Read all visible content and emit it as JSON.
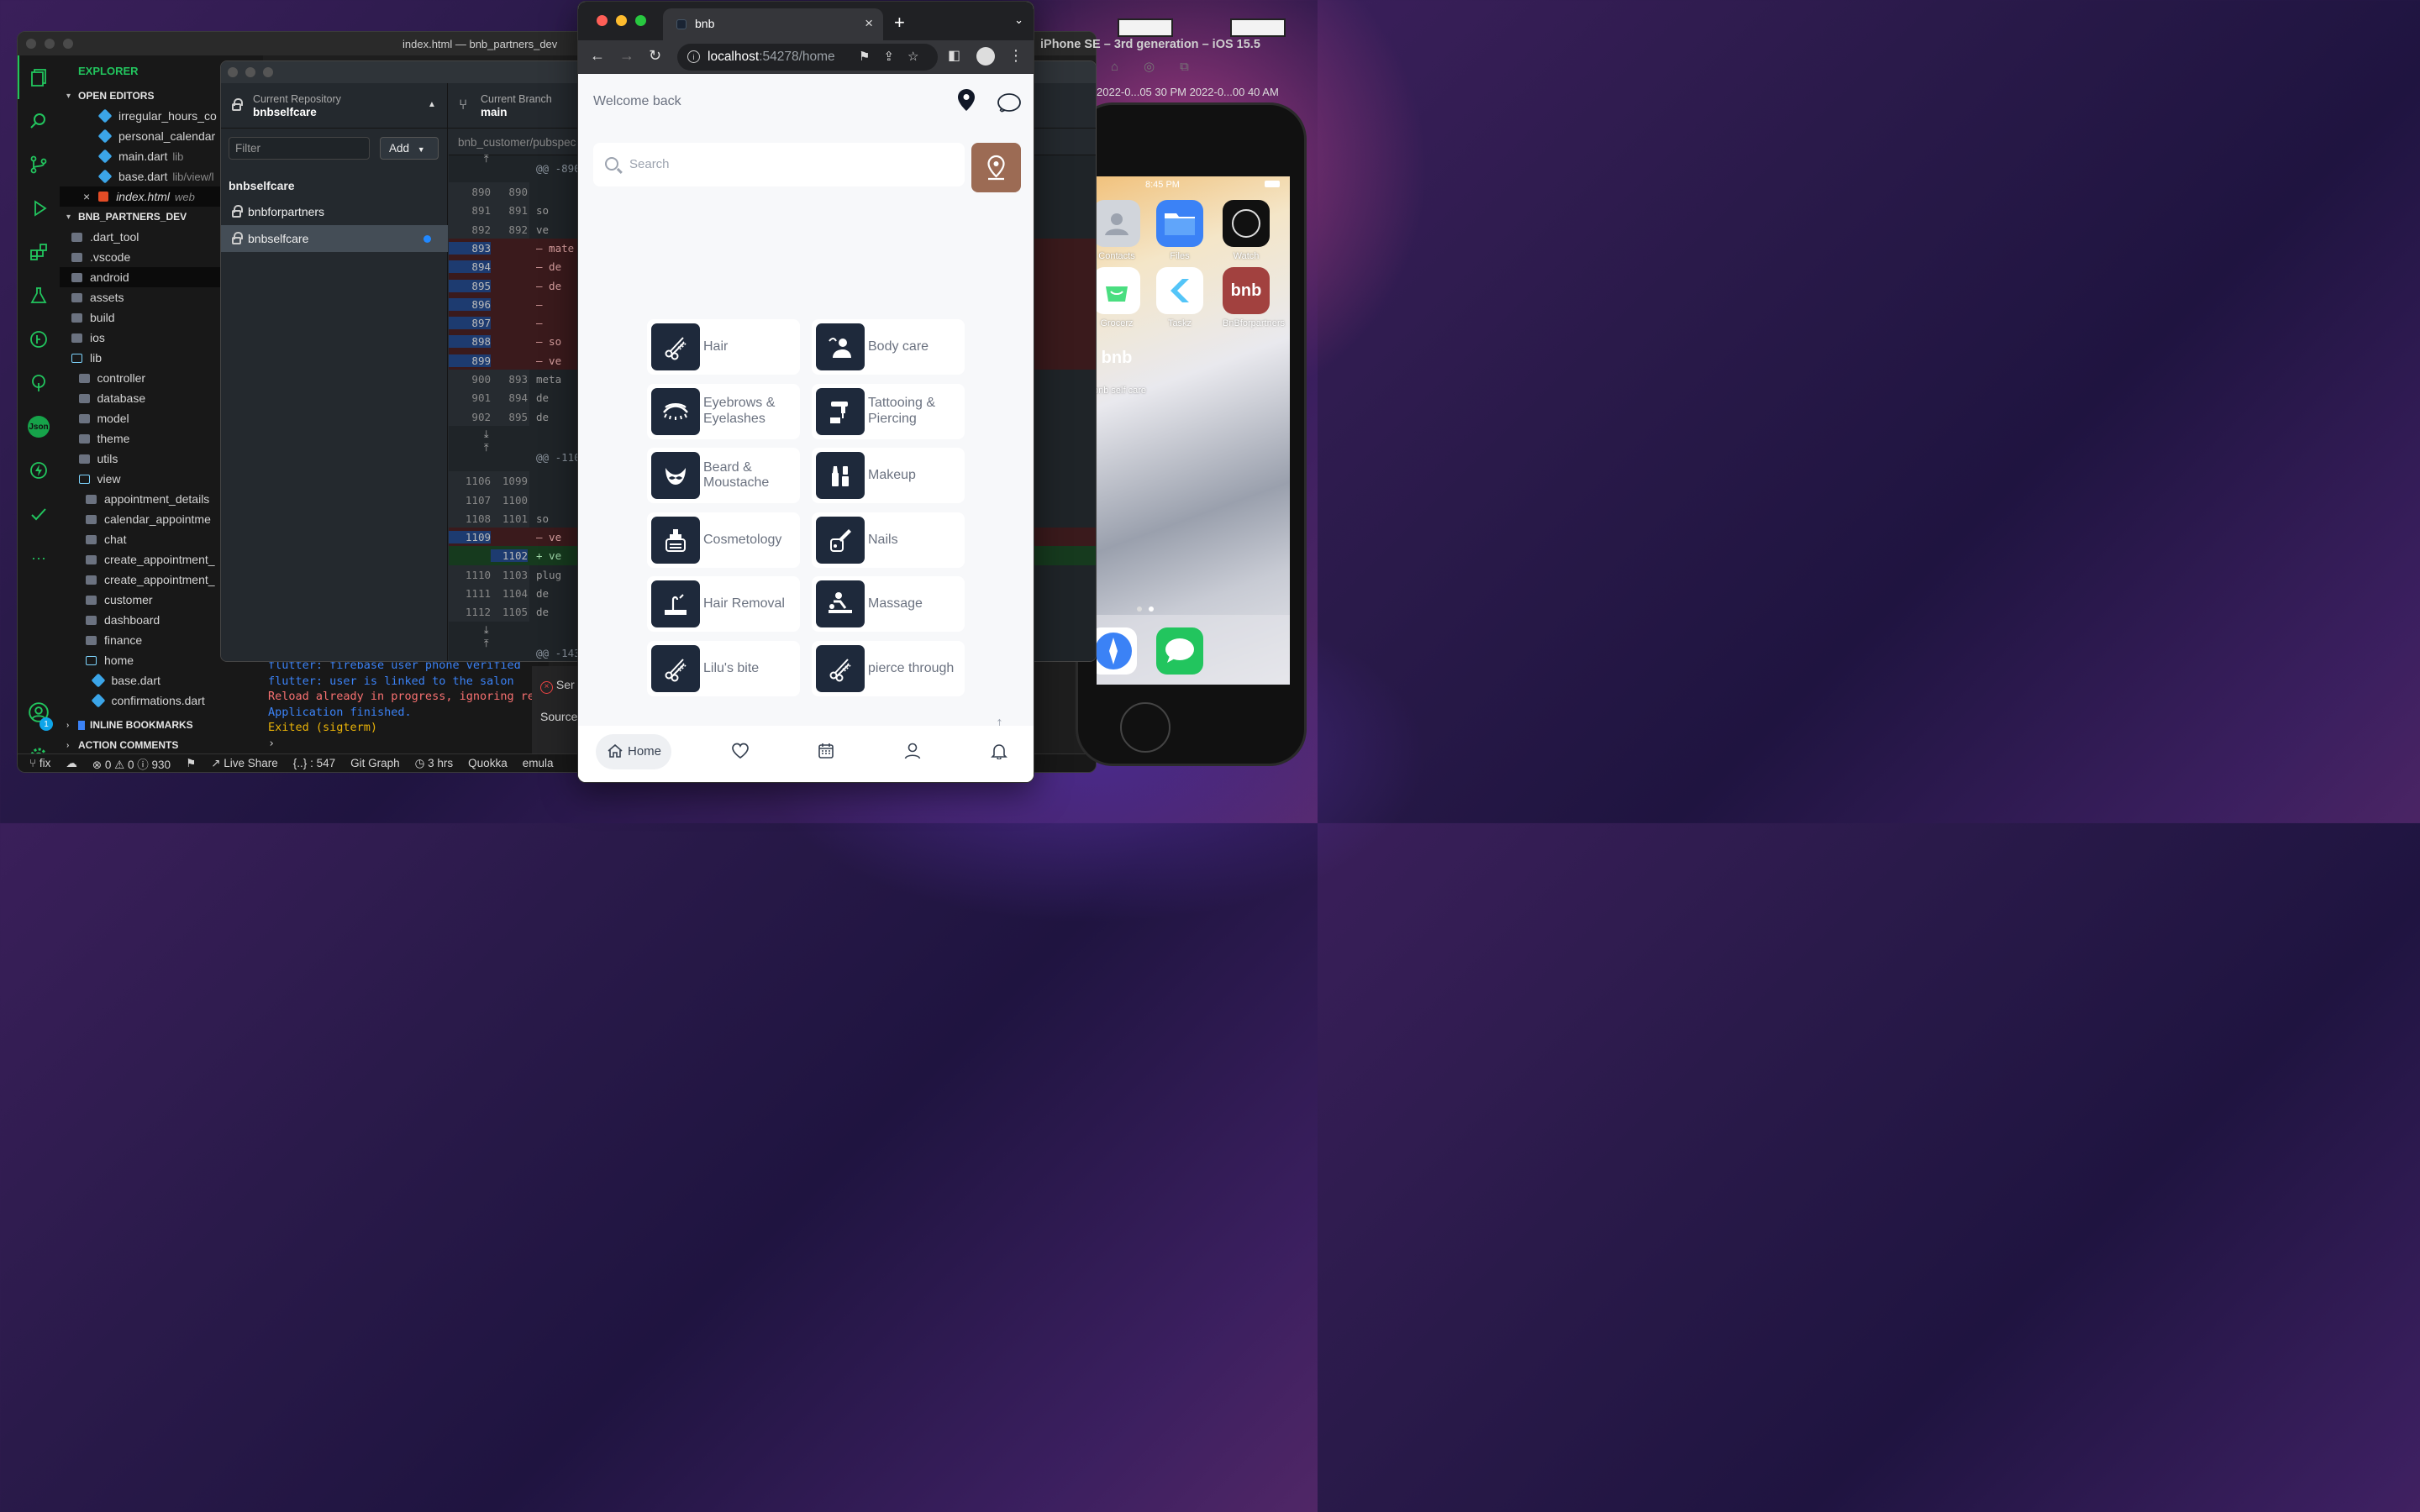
{
  "vscode": {
    "window_title": "index.html — bnb_partners_dev",
    "explorer_title": "EXPLORER",
    "open_editors_header": "OPEN EDITORS",
    "open_editors": [
      {
        "name": "irregular_hours_co",
        "hint": ""
      },
      {
        "name": "personal_calendar",
        "hint": ""
      },
      {
        "name": "main.dart",
        "hint": "lib"
      },
      {
        "name": "base.dart",
        "hint": "lib/view/l"
      },
      {
        "name": "index.html",
        "hint": "web"
      }
    ],
    "project_header": "BNB_PARTNERS_DEV",
    "tree": [
      {
        "name": ".dart_tool",
        "indent": 0
      },
      {
        "name": ".vscode",
        "indent": 0
      },
      {
        "name": "android",
        "indent": 0
      },
      {
        "name": "assets",
        "indent": 0
      },
      {
        "name": "build",
        "indent": 0
      },
      {
        "name": "ios",
        "indent": 0
      },
      {
        "name": "lib",
        "indent": 0
      },
      {
        "name": "controller",
        "indent": 1
      },
      {
        "name": "database",
        "indent": 1
      },
      {
        "name": "model",
        "indent": 1
      },
      {
        "name": "theme",
        "indent": 1
      },
      {
        "name": "utils",
        "indent": 1
      },
      {
        "name": "view",
        "indent": 1
      },
      {
        "name": "appointment_details",
        "indent": 2
      },
      {
        "name": "calendar_appointme",
        "indent": 2
      },
      {
        "name": "chat",
        "indent": 2
      },
      {
        "name": "create_appointment_",
        "indent": 2
      },
      {
        "name": "create_appointment_",
        "indent": 2
      },
      {
        "name": "customer",
        "indent": 2
      },
      {
        "name": "dashboard",
        "indent": 2
      },
      {
        "name": "finance",
        "indent": 2
      },
      {
        "name": "home",
        "indent": 2
      },
      {
        "name": "base.dart",
        "indent": 3
      },
      {
        "name": "confirmations.dart",
        "indent": 3
      }
    ],
    "inline_bookmarks": "INLINE BOOKMARKS",
    "action_comments": "ACTION COMMENTS",
    "terminal_lines": [
      {
        "text": "flutter: firebase user phone verified",
        "color": "blue"
      },
      {
        "text": "flutter: user is linked to the salon",
        "color": "blue"
      },
      {
        "text": "Reload already in progress, ignoring req",
        "color": "red"
      },
      {
        "text": "Application finished.",
        "color": "blue"
      },
      {
        "text": "Exited (sigterm)",
        "color": "yellow"
      }
    ],
    "problems_peek": [
      "Ser",
      "Source"
    ],
    "notification_badge": "1",
    "json_badge": "Json",
    "status": {
      "branch": "fix",
      "problems": "⊗ 0 ⚠ 0 ⓘ 930",
      "live_share": "Live Share",
      "brackets": "{..} : 547",
      "git_graph": "Git Graph",
      "time": "3 hrs",
      "quokka": "Quokka",
      "emulator": "emula"
    }
  },
  "github_desktop": {
    "current_repo_label": "Current Repository",
    "current_repo": "bnbselfcare",
    "current_branch_label": "Current Branch",
    "current_branch": "main",
    "filter_placeholder": "Filter",
    "add_label": "Add",
    "group_name": "bnbselfcare",
    "repos": [
      {
        "name": "bnbforpartners",
        "selected": false
      },
      {
        "name": "bnbselfcare",
        "selected": true
      }
    ],
    "diff_path": "bnb_customer/pubspec",
    "diff_rows": [
      {
        "t": "hunk",
        "a": "",
        "b": "",
        "text": "@@ -890"
      },
      {
        "t": "ctx",
        "a": "890",
        "b": "890",
        "text": ""
      },
      {
        "t": "ctx",
        "a": "891",
        "b": "891",
        "text": "  so"
      },
      {
        "t": "ctx",
        "a": "892",
        "b": "892",
        "text": "  ve"
      },
      {
        "t": "del",
        "a": "893",
        "b": "",
        "text": "– mate"
      },
      {
        "t": "del",
        "a": "894",
        "b": "",
        "text": "–   de"
      },
      {
        "t": "del",
        "a": "895",
        "b": "",
        "text": "–   de"
      },
      {
        "t": "del",
        "a": "896",
        "b": "",
        "text": "–"
      },
      {
        "t": "del",
        "a": "897",
        "b": "",
        "text": "–"
      },
      {
        "t": "del",
        "a": "898",
        "b": "",
        "text": "–   so"
      },
      {
        "t": "del",
        "a": "899",
        "b": "",
        "text": "–   ve"
      },
      {
        "t": "ctx",
        "a": "900",
        "b": "893",
        "text": "  meta"
      },
      {
        "t": "ctx",
        "a": "901",
        "b": "894",
        "text": "    de"
      },
      {
        "t": "ctx",
        "a": "902",
        "b": "895",
        "text": "    de"
      },
      {
        "t": "expand",
        "a": "",
        "b": "",
        "text": ""
      },
      {
        "t": "hunk",
        "a": "",
        "b": "",
        "text": "@@ -110"
      },
      {
        "t": "ctx",
        "a": "1106",
        "b": "1099",
        "text": ""
      },
      {
        "t": "ctx",
        "a": "1107",
        "b": "1100",
        "text": ""
      },
      {
        "t": "ctx",
        "a": "1108",
        "b": "1101",
        "text": "    so"
      },
      {
        "t": "del",
        "a": "1109",
        "b": "",
        "text": "–   ve"
      },
      {
        "t": "add",
        "a": "",
        "b": "1102",
        "text": "+   ve"
      },
      {
        "t": "ctx",
        "a": "1110",
        "b": "1103",
        "text": "  plug"
      },
      {
        "t": "ctx",
        "a": "1111",
        "b": "1104",
        "text": "    de"
      },
      {
        "t": "ctx",
        "a": "1112",
        "b": "1105",
        "text": "    de"
      },
      {
        "t": "expand",
        "a": "",
        "b": "",
        "text": ""
      },
      {
        "t": "hunk",
        "a": "",
        "b": "",
        "text": "@@ -143"
      }
    ]
  },
  "chrome": {
    "tab_title": "bnb",
    "url_host": "localhost",
    "url_path": ":54278/home"
  },
  "app": {
    "welcome": "Welcome back",
    "search_placeholder": "Search",
    "categories": [
      {
        "label": "Hair",
        "icon": "scissors-comb-icon"
      },
      {
        "label": "Body care",
        "icon": "body-care-icon"
      },
      {
        "label": "Eyebrows & Eyelashes",
        "icon": "eyelash-icon"
      },
      {
        "label": "Tattooing & Piercing",
        "icon": "tattoo-machine-icon"
      },
      {
        "label": "Beard & Moustache",
        "icon": "moustache-icon"
      },
      {
        "label": "Makeup",
        "icon": "makeup-icon"
      },
      {
        "label": "Cosmetology",
        "icon": "cosmetics-icon"
      },
      {
        "label": "Nails",
        "icon": "nail-polish-icon"
      },
      {
        "label": "Hair Removal",
        "icon": "hair-removal-icon"
      },
      {
        "label": "Massage",
        "icon": "massage-icon"
      },
      {
        "label": "Lilu's bite",
        "icon": "scissors-comb-icon"
      },
      {
        "label": "pierce through",
        "icon": "scissors-comb-icon"
      }
    ],
    "nav": {
      "home": "Home"
    },
    "accent": "#9c6b54",
    "icon_bg": "#1e293b"
  },
  "simulator": {
    "title": "iPhone SE – 3rd generation – iOS 15.5",
    "date_strip": "2022-0...05 30 PM   2022-0...00 40 AM",
    "time": "8:45 PM",
    "apps": [
      {
        "label": "Contacts",
        "color": "#d1d5db"
      },
      {
        "label": "Files",
        "color": "#3b82f6"
      },
      {
        "label": "Watch",
        "color": "#111111"
      },
      {
        "label": "Grocerz",
        "color": "#ffffff"
      },
      {
        "label": "Taskz",
        "color": "#ffffff"
      },
      {
        "label": "BnBforpartners",
        "color": "#a2413f"
      },
      {
        "label": "bnb self care",
        "color": "transparent"
      }
    ],
    "app_glyphs": {
      "bnb": "bnb"
    }
  }
}
